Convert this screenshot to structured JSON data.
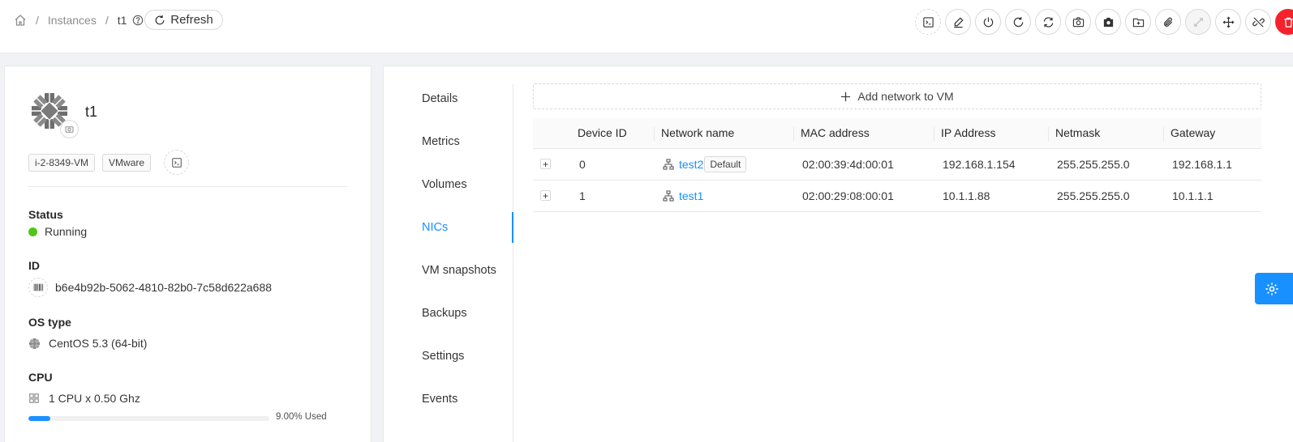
{
  "breadcrumb": {
    "instances": "Instances",
    "current": "t1"
  },
  "toolbar": {
    "refresh_label": "Refresh"
  },
  "actions": [
    "console",
    "edit",
    "stop",
    "reboot",
    "reinstall",
    "snapshot",
    "vm-snapshot",
    "backup",
    "attach-iso",
    "scale",
    "migrate",
    "unlink",
    "destroy"
  ],
  "vm": {
    "name": "t1",
    "instance_name": "i-2-8349-VM",
    "hypervisor": "VMware",
    "status_label": "Status",
    "status": "Running",
    "id_label": "ID",
    "id": "b6e4b92b-5062-4810-82b0-7c58d622a688",
    "os_label": "OS type",
    "os": "CentOS 5.3 (64-bit)",
    "cpu_label": "CPU",
    "cpu": "1 CPU x 0.50 Ghz",
    "cpu_used_fraction": 0.09,
    "cpu_used_text": "9.00% Used"
  },
  "tabs": [
    "Details",
    "Metrics",
    "Volumes",
    "NICs",
    "VM snapshots",
    "Backups",
    "Settings",
    "Events"
  ],
  "active_tab": "NICs",
  "nics": {
    "add_label": "Add network to VM",
    "columns": [
      "Device ID",
      "Network name",
      "MAC address",
      "IP Address",
      "Netmask",
      "Gateway"
    ],
    "default_tag": "Default",
    "rows": [
      {
        "device_id": "0",
        "network": "test2",
        "is_default": true,
        "mac": "02:00:39:4d:00:01",
        "ip": "192.168.1.154",
        "netmask": "255.255.255.0",
        "gateway": "192.168.1.1"
      },
      {
        "device_id": "1",
        "network": "test1",
        "is_default": false,
        "mac": "02:00:29:08:00:01",
        "ip": "10.1.1.88",
        "netmask": "255.255.255.0",
        "gateway": "10.1.1.1"
      }
    ]
  },
  "colors": {
    "primary": "#1890ff",
    "success": "#52c41a",
    "danger": "#f5222d"
  }
}
